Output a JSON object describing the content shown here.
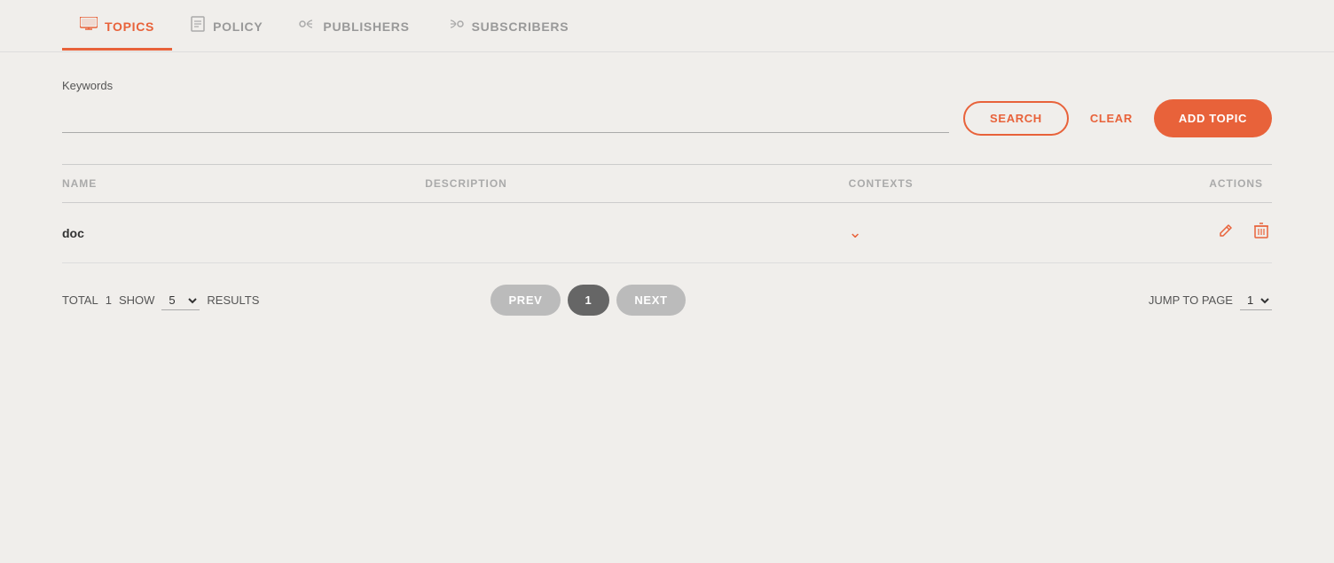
{
  "nav": {
    "tabs": [
      {
        "id": "topics",
        "label": "TOPICS",
        "icon": "🖥",
        "active": true
      },
      {
        "id": "policy",
        "label": "POLICY",
        "icon": "📋",
        "active": false
      },
      {
        "id": "publishers",
        "label": "PUBLISHERS",
        "icon": "·)",
        "active": false
      },
      {
        "id": "subscribers",
        "label": "SUBSCRIBERS",
        "icon": "(·",
        "active": false
      }
    ]
  },
  "search": {
    "keywords_label": "Keywords",
    "search_btn": "SEARCH",
    "clear_btn": "CLEAR",
    "add_topic_btn": "ADD TOPIC",
    "input_value": ""
  },
  "table": {
    "columns": [
      "NAME",
      "DESCRIPTION",
      "CONTEXTS",
      "ACTIONS"
    ],
    "rows": [
      {
        "name": "doc",
        "description": "",
        "contexts": "▾",
        "actions": [
          "edit",
          "delete"
        ]
      }
    ]
  },
  "pagination": {
    "total_label": "TOTAL",
    "total_count": "1",
    "show_label": "SHOW",
    "show_value": "5",
    "results_label": "RESULTS",
    "prev_btn": "PREV",
    "next_btn": "NEXT",
    "current_page": "1",
    "jump_label": "JUMP TO PAGE",
    "jump_value": "1"
  }
}
